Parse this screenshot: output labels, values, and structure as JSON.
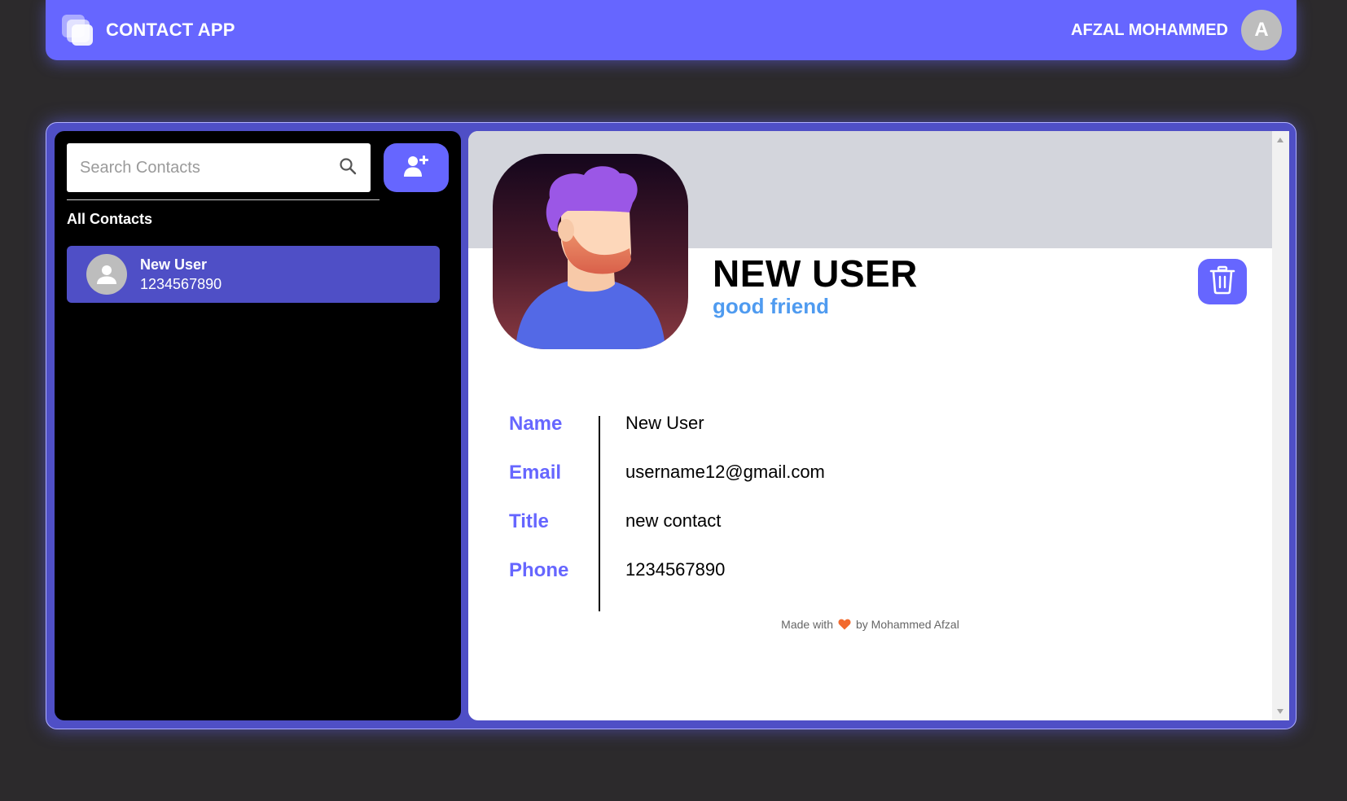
{
  "header": {
    "brand_title": "CONTACT APP",
    "user_name": "AFZAL MOHAMMED",
    "user_initial": "A"
  },
  "sidebar": {
    "search": {
      "placeholder": "Search Contacts",
      "value": ""
    },
    "section_label": "All Contacts",
    "contacts": [
      {
        "name": "New User",
        "phone": "1234567890"
      }
    ]
  },
  "detail": {
    "name": "NEW USER",
    "subtitle": "good friend",
    "fields": [
      {
        "label": "Name",
        "value": "New User"
      },
      {
        "label": "Email",
        "value": "username12@gmail.com"
      },
      {
        "label": "Title",
        "value": "new contact"
      },
      {
        "label": "Phone",
        "value": "1234567890"
      }
    ],
    "footer_prefix": "Made with",
    "footer_suffix": "by Mohammed Afzal"
  },
  "colors": {
    "accent": "#6666ff",
    "selected_item": "#4f4fc6",
    "subtitle": "#4f9bf0",
    "background": "#2c2a2c"
  }
}
